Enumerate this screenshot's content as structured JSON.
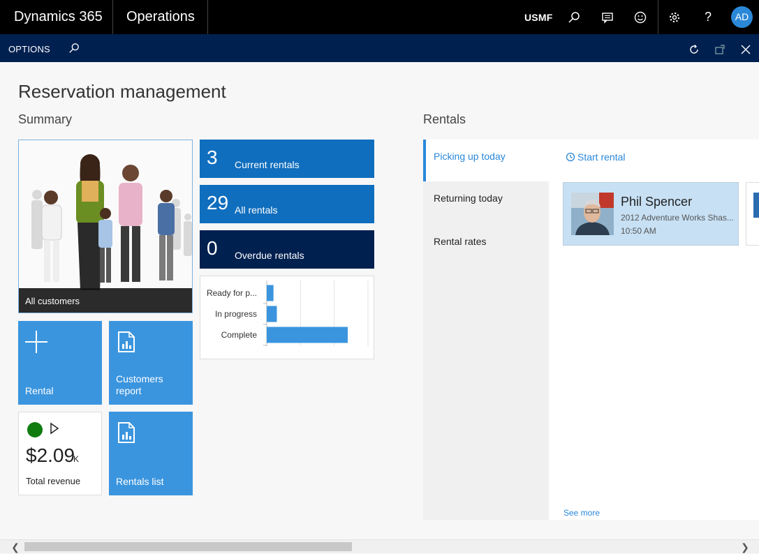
{
  "topbar": {
    "brand": "Dynamics 365",
    "module": "Operations",
    "company": "USMF",
    "avatar_initials": "AD"
  },
  "options_bar": {
    "label": "OPTIONS"
  },
  "page": {
    "title": "Reservation management"
  },
  "summary": {
    "heading": "Summary",
    "hero_caption": "All customers",
    "count_tiles": [
      {
        "number": "3",
        "label": "Current rentals",
        "color": "#106ebe"
      },
      {
        "number": "29",
        "label": "All rentals",
        "color": "#106ebe"
      },
      {
        "number": "0",
        "label": "Overdue rentals",
        "color": "#002050"
      }
    ],
    "status_chart": {
      "chart_data": {
        "type": "bar",
        "orientation": "horizontal",
        "categories": [
          "Ready for p...",
          "In progress",
          "Complete"
        ],
        "values": [
          2,
          3,
          24
        ],
        "xlim": [
          0,
          30
        ],
        "grid": true,
        "color": "#3b95de"
      }
    },
    "actions": {
      "rental_label": "Rental",
      "customers_report_label": "Customers report",
      "rentals_list_label": "Rentals list"
    },
    "kpi": {
      "value": "$2.09",
      "suffix": "K",
      "label": "Total revenue",
      "status_color": "#107c10"
    }
  },
  "rentals": {
    "heading": "Rentals",
    "nav": [
      {
        "label": "Picking up today",
        "active": true
      },
      {
        "label": "Returning today",
        "active": false
      },
      {
        "label": "Rental rates",
        "active": false
      }
    ],
    "start_rental_label": "Start rental",
    "card": {
      "name": "Phil Spencer",
      "vehicle": "2012 Adventure Works Shas...",
      "time": "10:50 AM"
    },
    "see_more": "See more"
  }
}
